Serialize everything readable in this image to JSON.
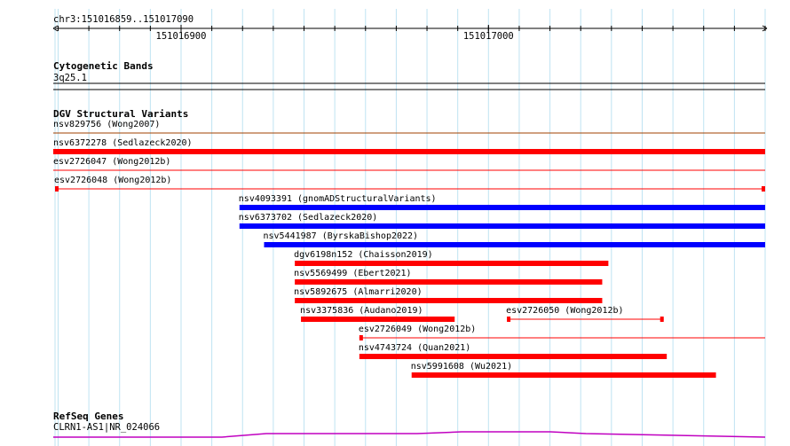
{
  "ruler": {
    "region": "chr3:151016859..151017090",
    "start": 151016859,
    "end": 151017090,
    "ticks": [
      {
        "pos": 151016900,
        "label": "151016900"
      },
      {
        "pos": 151017000,
        "label": "151017000"
      }
    ],
    "grid_step": 10
  },
  "tracks": {
    "cytoband": {
      "title": "Cytogenetic Bands",
      "band_label": "3q25.1"
    },
    "dgv": {
      "title": "DGV Structural Variants",
      "variants": [
        {
          "label": "nsv829756 (Wong2007)",
          "start": 151016859,
          "end": 151017090,
          "color": "#ff0000",
          "style": "thin",
          "line_color": "#a04000",
          "extends_left": true,
          "extends_right": true
        },
        {
          "label": "nsv6372278 (Sedlazeck2020)",
          "start": 151016859,
          "end": 151017090,
          "color": "#ff0000",
          "style": "thick",
          "extends_left": true,
          "extends_right": true
        },
        {
          "label": "esv2726047 (Wong2012b)",
          "start": 151016859,
          "end": 151017090,
          "color": "#ff0000",
          "style": "thin",
          "extends_left": true,
          "extends_right": true
        },
        {
          "label": "esv2726048 (Wong2012b)",
          "start": 151016859,
          "end": 151017090,
          "color": "#ff0000",
          "style": "endcaps",
          "extends_left": false,
          "extends_right": false
        },
        {
          "label": "nsv4093391 (gnomADStructuralVariants)",
          "start": 151016919,
          "end": 151017090,
          "color": "#0000ff",
          "style": "thick",
          "extends_right": true
        },
        {
          "label": "nsv6373702 (Sedlazeck2020)",
          "start": 151016919,
          "end": 151017090,
          "color": "#0000ff",
          "style": "thick",
          "extends_right": true
        },
        {
          "label": "nsv5441987 (ByrskaBishop2022)",
          "start": 151016927,
          "end": 151017090,
          "color": "#0000ff",
          "style": "thick",
          "extends_right": true
        },
        {
          "label": "dgv6198n152 (Chaisson2019)",
          "start": 151016937,
          "end": 151017039,
          "color": "#ff0000",
          "style": "thick"
        },
        {
          "label": "nsv5569499 (Ebert2021)",
          "start": 151016937,
          "end": 151017037,
          "color": "#ff0000",
          "style": "thick"
        },
        {
          "label": "nsv5892675 (Almarri2020)",
          "start": 151016937,
          "end": 151017037,
          "color": "#ff0000",
          "style": "thick"
        },
        {
          "label": "nsv3375836 (Audano2019)",
          "start": 151016939,
          "end": 151016989,
          "color": "#ff0000",
          "style": "thick"
        },
        {
          "label": "esv2726050 (Wong2012b)",
          "start": 151017006,
          "end": 151017057,
          "color": "#ff0000",
          "style": "endcaps",
          "same_row_as_previous": true
        },
        {
          "label": "esv2726049 (Wong2012b)",
          "start": 151016958,
          "end": 151017090,
          "color": "#ff0000",
          "style": "leftcap",
          "extends_right": true
        },
        {
          "label": "nsv4743724 (Quan2021)",
          "start": 151016958,
          "end": 151017058,
          "color": "#ff0000",
          "style": "thick"
        },
        {
          "label": "nsv5991608 (Wu2021)",
          "start": 151016975,
          "end": 151017074,
          "color": "#ff0000",
          "style": "thick"
        }
      ]
    },
    "refseq": {
      "title": "RefSeq Genes",
      "gene_label": "CLRN1-AS1|NR_024066",
      "color": "#c000c0"
    }
  }
}
